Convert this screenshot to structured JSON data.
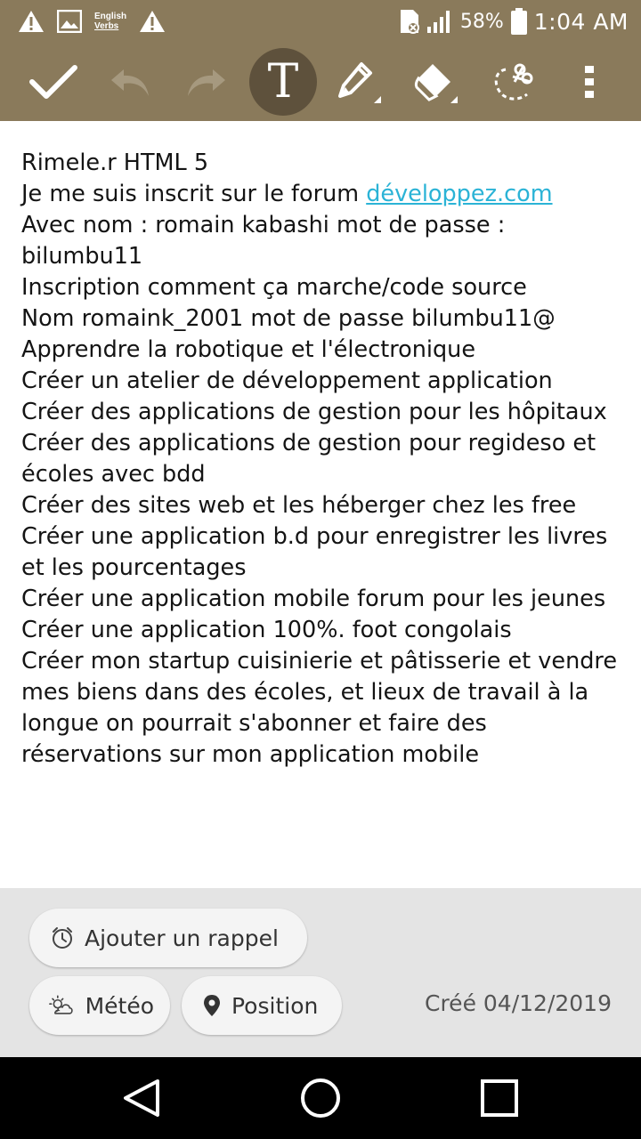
{
  "status_bar": {
    "left_icons": [
      "warning-icon",
      "image-icon",
      "english-verbs-icon",
      "warning-icon"
    ],
    "english_verbs": {
      "line1": "English",
      "line2": "Verbs"
    },
    "battery_percent": "58%",
    "time": "1:04 AM"
  },
  "toolbar": {
    "buttons": [
      "check-icon",
      "undo-icon",
      "redo-icon",
      "text-icon",
      "pen-icon",
      "eraser-icon",
      "lasso-icon",
      "more-icon"
    ],
    "text_glyph": "T"
  },
  "note": {
    "lines": [
      "Rimele.r HTML 5",
      "Je me suis inscrit sur le forum ",
      "Avec nom : romain kabashi mot de passe : bilumbu11",
      "Inscription comment ça marche/code source",
      "Nom romaink_2001 mot de passe bilumbu11@",
      "Apprendre la robotique et l'électronique",
      "Créer un atelier de développement application",
      "Créer des applications de gestion pour les hôpitaux",
      "Créer des applications de gestion pour regideso et écoles avec bdd",
      "Créer des sites web et les héberger chez les free",
      "Créer une application b.d pour enregistrer les livres et les pourcentages",
      "Créer une application mobile forum pour les jeunes",
      "Créer une application 100%. foot congolais",
      "Créer mon startup cuisinierie et pâtisserie et vendre mes biens dans des écoles, et lieux de travail à la longue on pourrait s'abonner et faire des réservations sur mon application mobile"
    ],
    "link": "développez.com"
  },
  "panel": {
    "reminder_label": "Ajouter un rappel",
    "weather_label": "Météo",
    "position_label": "Position",
    "created_label": "Créé 04/12/2019"
  },
  "nav": {
    "buttons": [
      "back-icon",
      "home-icon",
      "recents-icon"
    ]
  }
}
